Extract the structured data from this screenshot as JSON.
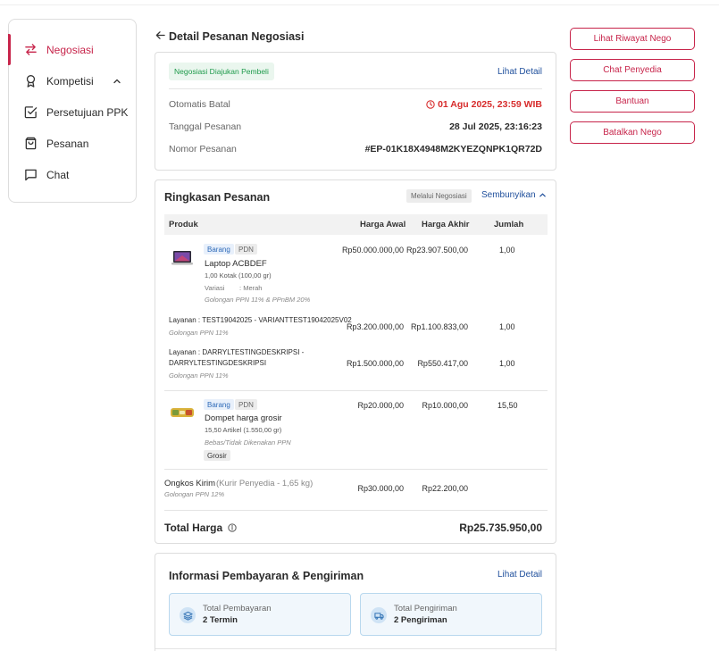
{
  "sidebar": {
    "items": [
      {
        "label": "Negosiasi",
        "icon": "swap-arrows-icon",
        "active": true
      },
      {
        "label": "Kompetisi",
        "icon": "award-icon",
        "active": false
      },
      {
        "label": "Persetujuan PPK",
        "icon": "checkbox-icon",
        "active": false
      },
      {
        "label": "Pesanan",
        "icon": "shopping-bag-icon",
        "active": false
      },
      {
        "label": "Chat",
        "icon": "chat-icon",
        "active": false
      }
    ]
  },
  "actions": {
    "riwayat": "Lihat Riwayat Nego",
    "chat_penyedia": "Chat Penyedia",
    "bantuan": "Bantuan",
    "batalkan": "Batalkan Nego"
  },
  "header": {
    "title": "Detail Pesanan Negosiasi"
  },
  "summary_card": {
    "status_badge": "Negosiasi Diajukan Pembeli",
    "detail_link": "Lihat Detail",
    "rows": [
      {
        "label": "Otomatis Batal",
        "value": "01 Agu 2025, 23:59 WIB"
      },
      {
        "label": "Tanggal Pesanan",
        "value": "28 Jul 2025, 23:16:23"
      },
      {
        "label": "Nomor Pesanan",
        "value": "#EP-01K18X4948M2KYEZQNPK1QR72D"
      }
    ]
  },
  "ringkasan": {
    "title": "Ringkasan Pesanan",
    "via": "Melalui Negosiasi",
    "toggle": "Sembunyikan",
    "columns": {
      "produk": "Produk",
      "harga_awal": "Harga Awal",
      "harga_akhir": "Harga Akhir",
      "jumlah": "Jumlah"
    },
    "product1": {
      "tag1": "Barang",
      "tag2": "PDN",
      "name": "Laptop ACBDEF",
      "qty_text": "1,00 Kotak (100,00 gr)",
      "variant": "Variasi        : Merah",
      "tax": "Golongan PPN 11% & PPnBM 20%",
      "harga_awal": "Rp50.000.000,00",
      "harga_akhir": "Rp23.907.500,00",
      "jumlah": "1,00"
    },
    "layanan1": {
      "name": "Layanan : TEST19042025 - VARIANTTEST19042025V02",
      "tax": "Golongan PPN 11%",
      "harga_awal": "Rp3.200.000,00",
      "harga_akhir": "Rp1.100.833,00",
      "jumlah": "1,00"
    },
    "layanan2": {
      "line1": "Layanan : DARRYLTESTINGDESKRIPSI -",
      "line2": "DARRYLTESTINGDESKRIPSI",
      "tax": "Golongan PPN 11%",
      "harga_awal": "Rp1.500.000,00",
      "harga_akhir": "Rp550.417,00",
      "jumlah": "1,00"
    },
    "product2": {
      "tag1": "Barang",
      "tag2": "PDN",
      "name": "Dompet harga grosir",
      "qty_text": "15,50 Artikel (1.550,00 gr)",
      "tax": "Bebas/Tidak Dikenakan PPN",
      "grosir": "Grosir",
      "harga_awal": "Rp20.000,00",
      "harga_akhir": "Rp10.000,00",
      "jumlah": "15,50"
    },
    "ongkir": {
      "label": "Ongkos Kirim",
      "detail": "(Kurir Penyedia - 1,65 kg)",
      "tax": "Golongan PPN 12%",
      "harga_awal": "Rp30.000,00",
      "harga_akhir": "Rp22.200,00"
    },
    "total_label": "Total Harga",
    "total_value": "Rp25.735.950,00"
  },
  "pembayaran": {
    "title": "Informasi Pembayaran & Pengiriman",
    "detail_link": "Lihat Detail",
    "box1": {
      "label": "Total Pembayaran",
      "value": "2 Termin"
    },
    "box2": {
      "label": "Total Pengiriman",
      "value": "2 Pengiriman"
    }
  },
  "colors": {
    "brand": "#c7244a",
    "link": "#1f4f9c",
    "success": "#1e9a4b",
    "danger": "#d72c2c"
  }
}
